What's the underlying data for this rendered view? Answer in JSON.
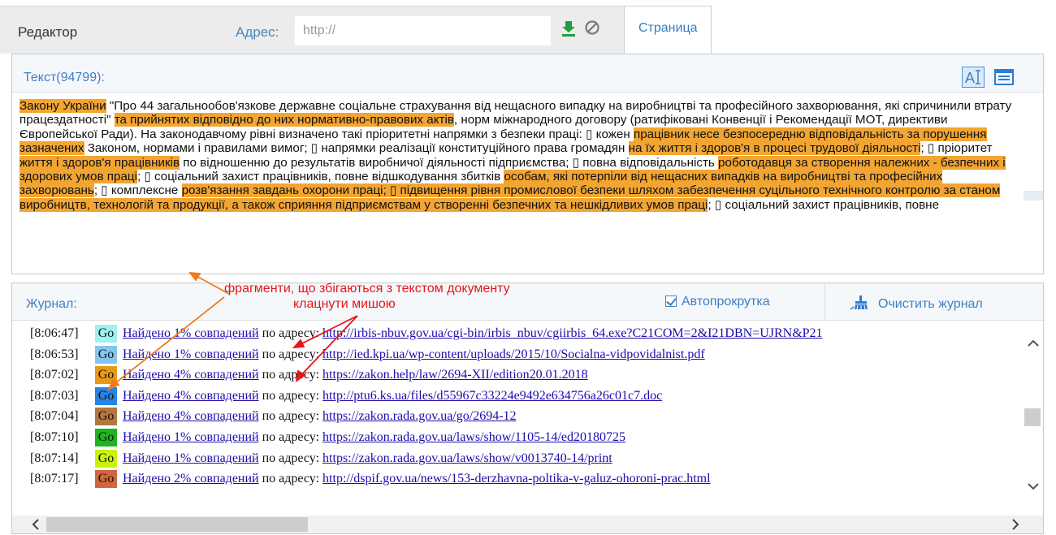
{
  "topbar": {
    "editor_title": "Редактор",
    "address_label": "Адрес:",
    "address_placeholder": "http://",
    "page_tab": "Страница"
  },
  "text_panel": {
    "label": "Текст(94799):",
    "segments": [
      {
        "t": "Закону України",
        "h": true
      },
      {
        "t": " \"Про 44  загальнообов'язкове державне соціальне страхування від нещасного випадку на виробництві та професійного захворювання, які спричинили втрату працездатності\" ",
        "h": false
      },
      {
        "t": "та прийнятих відповідно до них нормативно-правових актів",
        "h": true
      },
      {
        "t": ", норм міжнародного договору (ратифіковані Конвенції і Рекомендації МОТ, директиви Європейської Ради).  На законодавчому рівні визначено такі пріоритетні напрямки з безпеки праці: ▯ кожен ",
        "h": false
      },
      {
        "t": "працівник несе безпосередню відповідальність за порушення зазначених",
        "h": true
      },
      {
        "t": " Законом, нормами і правилами вимог; ▯ напрямки реалізації конституційного права громадян ",
        "h": false
      },
      {
        "t": "на їх життя і здоров'я в процесі трудової діяльності",
        "h": true
      },
      {
        "t": "; ▯ пріоритет ",
        "h": false
      },
      {
        "t": "життя і здоров'я працівників",
        "h": true
      },
      {
        "t": " по відношенню до результатів виробничої діяльності підприємства; ▯ повна відповідальність ",
        "h": false
      },
      {
        "t": "роботодавця за створення належних - безпечних і здорових умов праці",
        "h": true
      },
      {
        "t": "; ▯ соціальний захист працівників, повне відшкодування збитків ",
        "h": false
      },
      {
        "t": "особам, які потерпіли від нещасних випадків на виробництві та професійних захворювань",
        "h": true
      },
      {
        "t": "; ▯ комплексне ",
        "h": false
      },
      {
        "t": "розв'язання завдань охорони праці; ▯ підвищення рівня промислової безпеки шляхом забезпечення суцільного технічного контролю за станом виробництв, технологій та продукції, а також сприяння підприємствам у створенні безпечних та нешкідливих умов праці",
        "h": true
      },
      {
        "t": "; ▯ соціальний захист працівників, повне",
        "h": false
      }
    ]
  },
  "log_panel": {
    "label": "Журнал:",
    "autoscroll_label": "Автопрокрутка",
    "autoscroll_checked": true,
    "clear_label": "Очистить журнал",
    "entries": [
      {
        "time": "[8:06:47]",
        "go": "Go",
        "color": "#9ff0f0",
        "link": "Найдено 1% совпадений",
        "middle": " по адресу: ",
        "url": "http://irbis-nbuv.gov.ua/cgi-bin/irbis_nbuv/cgiirbis_64.exe?C21COM=2&I21DBN=UJRN&P21"
      },
      {
        "time": "[8:06:53]",
        "go": "Go",
        "color": "#84c5ee",
        "link": "Найдено 1% совпадений",
        "middle": " по адресу: ",
        "url": "http://ied.kpi.ua/wp-content/uploads/2015/10/Socialna-vidpovidalnist.pdf"
      },
      {
        "time": "[8:07:02]",
        "go": "Go",
        "color": "#e89a16",
        "link": "Найдено 4% совпадений",
        "middle": " по адресу: ",
        "url": "https://zakon.help/law/2694-XII/edition20.01.2018"
      },
      {
        "time": "[8:07:03]",
        "go": "Go",
        "color": "#2784e0",
        "link": "Найдено 4% совпадений",
        "middle": " по адресу: ",
        "url": "http://ptu6.ks.ua/files/d55967c33224e9492e634756a26c01c7.doc"
      },
      {
        "time": "[8:07:04]",
        "go": "Go",
        "color": "#b27740",
        "link": "Найдено 4% совпадений",
        "middle": " по адресу: ",
        "url": "https://zakon.rada.gov.ua/go/2694-12"
      },
      {
        "time": "[8:07:10]",
        "go": "Go",
        "color": "#1fb31f",
        "link": "Найдено 1% совпадений",
        "middle": " по адресу: ",
        "url": "https://zakon.rada.gov.ua/laws/show/1105-14/ed20180725"
      },
      {
        "time": "[8:07:14]",
        "go": "Go",
        "color": "#c9f20a",
        "link": "Найдено 1% совпадений",
        "middle": " по адресу: ",
        "url": "https://zakon.rada.gov.ua/laws/show/v0013740-14/print"
      },
      {
        "time": "[8:07:17]",
        "go": "Go",
        "color": "#d2653d",
        "link": "Найдено 2% совпадений",
        "middle": " по адресу: ",
        "url": "http://dspif.gov.ua/news/153-derzhavna-poltika-v-galuz-ohoroni-prac.html"
      }
    ]
  },
  "annotation": {
    "line1": "фрагменти, що збігаються з текстом документу",
    "line2": "клацнути мишою",
    "color": "#e8141a"
  },
  "colors": {
    "accent_blue": "#3f7ec1",
    "highlight": "#f2a532",
    "download_green": "#1f9e3c"
  },
  "icons": [
    "download-icon",
    "block-icon",
    "text-mode-icon",
    "list-mode-icon",
    "checkbox-checked-icon",
    "broom-icon",
    "chevron-up-icon",
    "chevron-down-icon",
    "chevron-left-icon",
    "chevron-right-icon",
    "arrow-annotation"
  ]
}
